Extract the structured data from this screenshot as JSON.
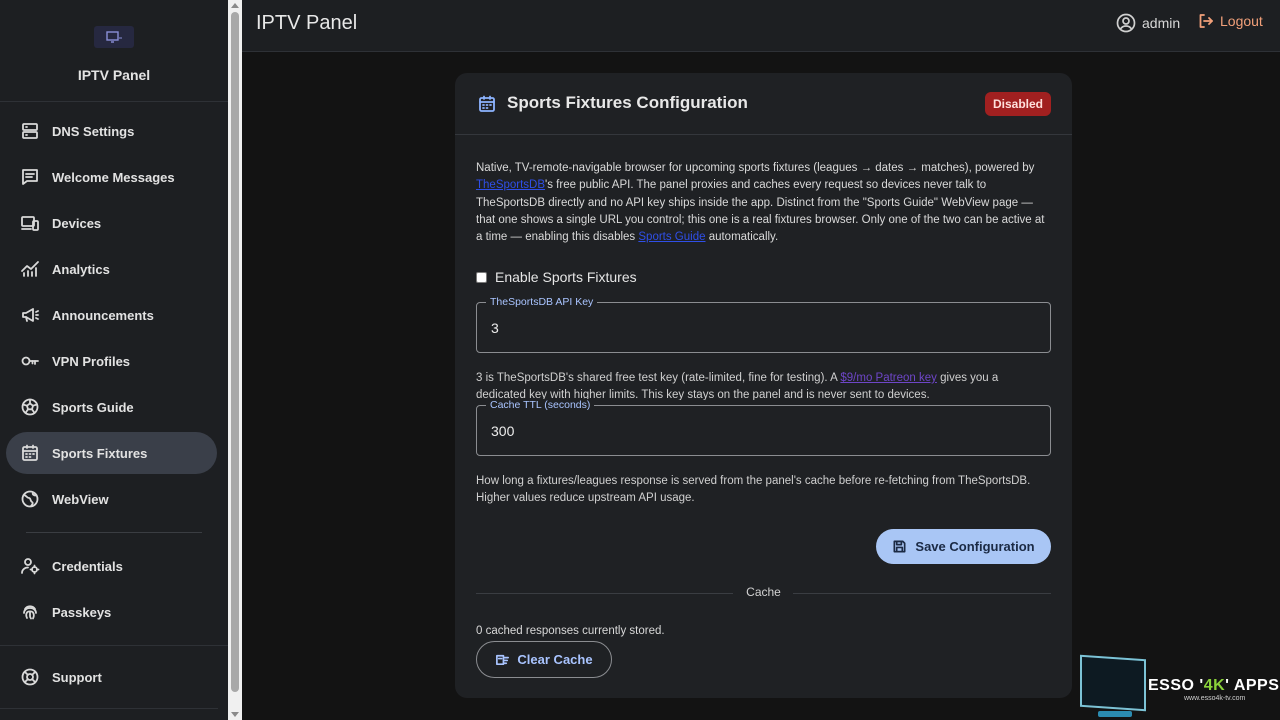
{
  "sidebar": {
    "brand_title": "IPTV Panel",
    "items": [
      {
        "label": "DNS Settings",
        "icon": "dns-icon",
        "active": false
      },
      {
        "label": "Welcome Messages",
        "icon": "message-icon",
        "active": false
      },
      {
        "label": "Devices",
        "icon": "devices-icon",
        "active": false
      },
      {
        "label": "Analytics",
        "icon": "analytics-icon",
        "active": false
      },
      {
        "label": "Announcements",
        "icon": "megaphone-icon",
        "active": false
      },
      {
        "label": "VPN Profiles",
        "icon": "key-icon",
        "active": false
      },
      {
        "label": "Sports Guide",
        "icon": "soccer-ball-icon",
        "active": false
      },
      {
        "label": "Sports Fixtures",
        "icon": "calendar-icon",
        "active": true
      },
      {
        "label": "WebView",
        "icon": "globe-icon",
        "active": false
      }
    ],
    "secondary_items": [
      {
        "label": "Credentials",
        "icon": "user-key-icon"
      },
      {
        "label": "Passkeys",
        "icon": "fingerprint-icon"
      }
    ],
    "support_item": {
      "label": "Support",
      "icon": "lifebuoy-icon"
    }
  },
  "header": {
    "title": "IPTV Panel",
    "user_name": "admin",
    "logout_label": "Logout"
  },
  "card": {
    "title": "Sports Fixtures Configuration",
    "status_badge": "Disabled",
    "description": {
      "part1": "Native, TV-remote-navigable browser for upcoming sports fixtures (leagues → dates → matches), powered by ",
      "link1": "TheSportsDB",
      "part2": "'s free public API. The panel proxies and caches every request so devices never talk to TheSportsDB directly and no API key ships inside the app. Distinct from the \"Sports Guide\" WebView page — that one shows a single URL you control; this one is a real fixtures browser. Only one of the two can be active at a time — enabling this disables ",
      "link2": "Sports Guide",
      "part3": " automatically."
    },
    "enable_label": "Enable Sports Fixtures",
    "enable_checked": false,
    "api_key": {
      "label": "TheSportsDB API Key",
      "value": "3",
      "hint_part1": "3 is TheSportsDB's shared free test key (rate-limited, fine for testing). A ",
      "hint_link": "$9/mo Patreon key",
      "hint_part2": " gives you a dedicated key with higher limits. This key stays on the panel and is never sent to devices."
    },
    "cache_ttl": {
      "label": "Cache TTL (seconds)",
      "value": "300",
      "hint": "How long a fixtures/leagues response is served from the panel's cache before re-fetching from TheSportsDB. Higher values reduce upstream API usage."
    },
    "save_label": "Save Configuration",
    "cache_section_label": "Cache",
    "cache_status": "0 cached responses currently stored.",
    "clear_cache_label": "Clear Cache"
  },
  "watermark": {
    "title_part1": "ESSO '",
    "title_accent": "4K",
    "title_part2": "' APPS",
    "url": "www.esso4k-tv.com"
  },
  "colors": {
    "accent": "#a9c6f5",
    "badge_disabled": "#a12020",
    "logout": "#f2a07a",
    "active_nav": "#3a3f49"
  }
}
